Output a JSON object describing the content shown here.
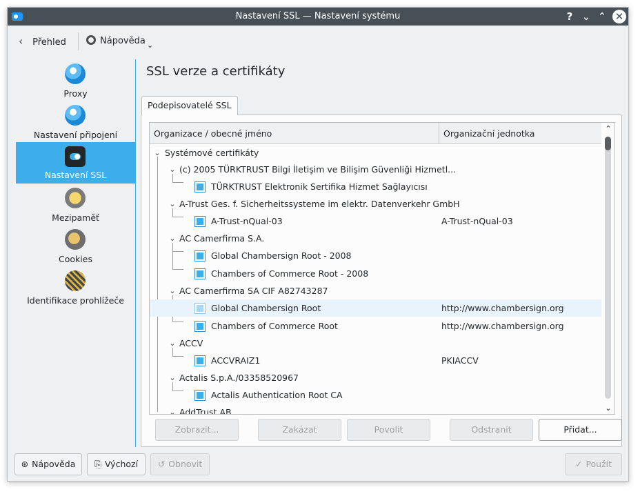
{
  "window": {
    "title": "Nastavení SSL  — Nastavení systému",
    "buttons": {
      "help": "?",
      "minimize": "⌄",
      "maximize": "⌃",
      "close": "✕"
    }
  },
  "toolbar": {
    "back_label": "Přehled",
    "help_label": "Nápověda"
  },
  "sidebar": {
    "items": [
      {
        "label": "Proxy",
        "icon": "proxy-globe-icon"
      },
      {
        "label": "Nastavení připojení",
        "icon": "connection-globe-icon"
      },
      {
        "label": "Nastavení SSL",
        "icon": "ssl-toggle-icon",
        "active": true
      },
      {
        "label": "Mezipaměť",
        "icon": "cache-icon"
      },
      {
        "label": "Cookies",
        "icon": "cookie-icon"
      },
      {
        "label": "Identifikace prohlížeče",
        "icon": "browser-id-icon"
      }
    ]
  },
  "main": {
    "title": "SSL verze a certifikáty",
    "tab_label": "Podepisovatelé SSL",
    "columns": [
      "Organizace / obecné jméno",
      "Organizační jednotka"
    ],
    "root": "Systémové certifikáty",
    "tree": [
      {
        "label": "(c) 2005 TÜRKTRUST Bilgi İletişim ve Bilişim Güvenliği Hizmetl...",
        "unit": ""
      },
      {
        "label": "TÜRKTRUST Elektronik Sertifika Hizmet Sağlayıcısı",
        "unit": ""
      },
      {
        "label": "A-Trust Ges. f. Sicherheitssysteme im elektr. Datenverkehr GmbH",
        "unit": ""
      },
      {
        "label": "A-Trust-nQual-03",
        "unit": "A-Trust-nQual-03"
      },
      {
        "label": "AC Camerfirma S.A.",
        "unit": ""
      },
      {
        "label": "Global Chambersign Root - 2008",
        "unit": ""
      },
      {
        "label": "Chambers of Commerce Root - 2008",
        "unit": ""
      },
      {
        "label": "AC Camerfirma SA CIF A82743287",
        "unit": ""
      },
      {
        "label": "Global Chambersign Root",
        "unit": "http://www.chambersign.org"
      },
      {
        "label": "Chambers of Commerce Root",
        "unit": "http://www.chambersign.org"
      },
      {
        "label": "ACCV",
        "unit": ""
      },
      {
        "label": "ACCVRAIZ1",
        "unit": "PKIACCV"
      },
      {
        "label": "Actalis S.p.A./03358520967",
        "unit": ""
      },
      {
        "label": "Actalis Authentication Root CA",
        "unit": ""
      },
      {
        "label": "AddTrust AB",
        "unit": ""
      }
    ],
    "buttons": {
      "show": "Zobrazit...",
      "disallow": "Zakázat",
      "allow": "Povolit",
      "remove": "Odstranit",
      "add": "Přidat..."
    }
  },
  "footer": {
    "help": "Nápověda",
    "defaults": "Výchozí",
    "reset": "Obnovit",
    "apply": "Použít"
  },
  "colors": {
    "accent": "#3daee9",
    "titlebar": "#475057",
    "window_bg": "#eff0f1"
  }
}
